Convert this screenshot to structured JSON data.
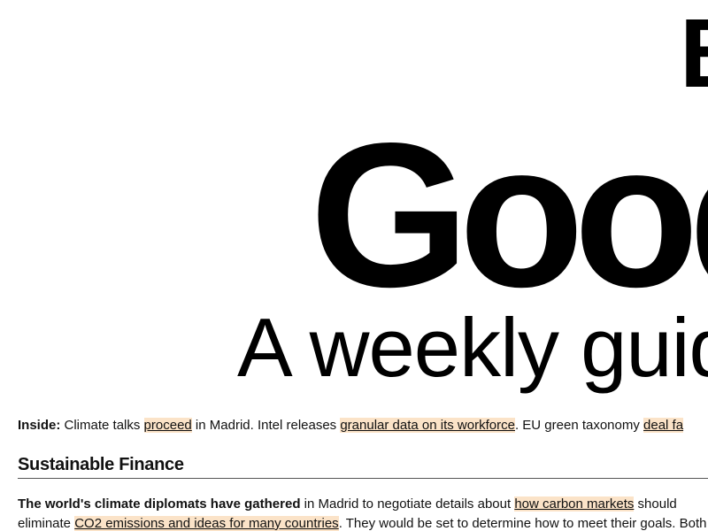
{
  "masthead": {
    "brand": "B",
    "title": "Good",
    "tagline": "A weekly guid"
  },
  "inside": {
    "label": "Inside:",
    "text1": " Climate talks ",
    "link1": "proceed",
    "text2": " in Madrid. Intel releases ",
    "link2": "granular data on its workforce",
    "text3": ". EU green taxonomy ",
    "link3": "deal fa"
  },
  "section": {
    "heading": "Sustainable Finance"
  },
  "paragraph": {
    "lead": "The world's climate diplomats have gathered",
    "text1": " in Madrid to negotiate details about ",
    "link1": "how carbon markets",
    "text2": " should",
    "line2_text1": "eliminate ",
    "line2_link1": "CO2 emissions and ideas for many countries",
    "line2_text2": ". They would be set to determine how to meet their goals. Both sides"
  }
}
